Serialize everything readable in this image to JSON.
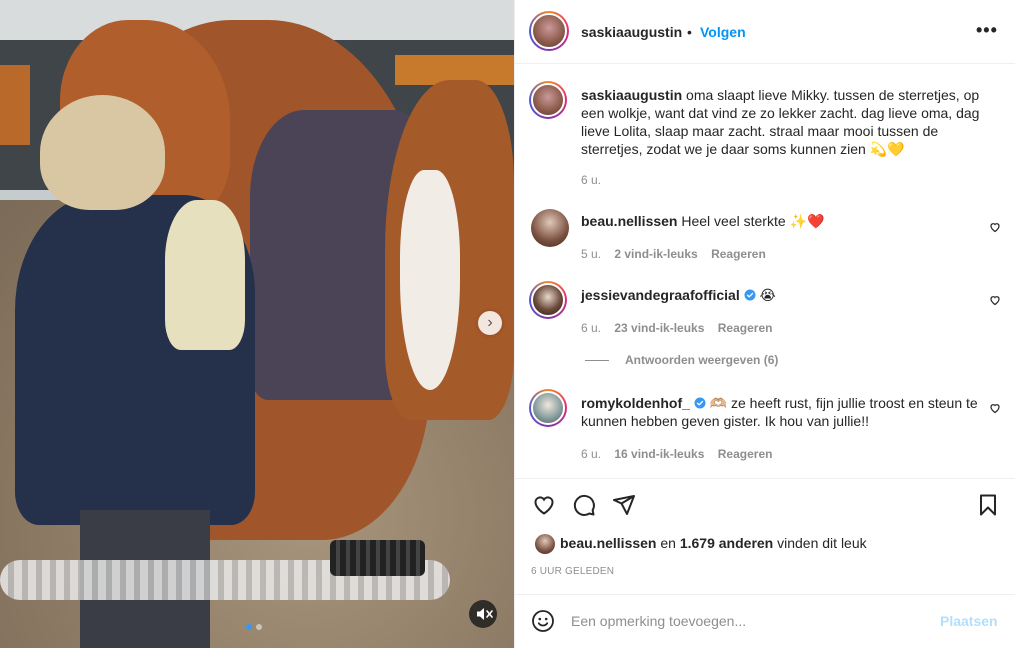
{
  "media": {
    "current_slide": 1,
    "slide_count": 2,
    "next_icon": "chevron-right-icon",
    "mute_icon": "speaker-muted-icon"
  },
  "header": {
    "username": "saskiaaugustin",
    "separator": "•",
    "follow_label": "Volgen",
    "more_label": "•••"
  },
  "caption": {
    "username": "saskiaaugustin",
    "text": "oma slaapt lieve Mikky. tussen de sterretjes, op een wolkje, want dat vind ze zo lekker zacht. dag lieve oma, dag lieve Lolita, slaap maar zacht. straal maar mooi tussen de sterretjes, zodat we je daar soms kunnen zien 💫💛",
    "time": "6 u."
  },
  "comments": [
    {
      "username": "beau.nellissen",
      "verified": false,
      "text": "Heel veel sterkte ✨❤️",
      "time": "5 u.",
      "likes": "2 vind-ik-leuks",
      "reply_label": "Reageren"
    },
    {
      "username": "jessievandegraafofficial",
      "verified": true,
      "text": "😭",
      "time": "6 u.",
      "likes": "23 vind-ik-leuks",
      "reply_label": "Reageren",
      "view_replies": "Antwoorden weergeven (6)"
    },
    {
      "username": "romykoldenhof_",
      "verified": true,
      "text": "🫶🏼 ze heeft rust, fijn jullie troost en steun te kunnen hebben geven gister. Ik hou van jullie!!",
      "time": "6 u.",
      "likes": "16 vind-ik-leuks",
      "reply_label": "Reageren"
    }
  ],
  "actions": {
    "like_icon": "heart-icon",
    "comment_icon": "comment-bubble-icon",
    "share_icon": "paper-plane-icon",
    "save_icon": "bookmark-icon"
  },
  "likes": {
    "liked_by": "beau.nellissen",
    "connector": "en",
    "others": "1.679 anderen",
    "suffix": "vinden dit leuk"
  },
  "posted": "6 UUR GELEDEN",
  "add_comment": {
    "placeholder": "Een opmerking toevoegen...",
    "post_label": "Plaatsen"
  },
  "colors": {
    "accent": "#0095f6",
    "post_disabled": "#b2dffc",
    "muted_text": "#8e8e8e",
    "text": "#262626",
    "like_heart": "#ed4956"
  }
}
